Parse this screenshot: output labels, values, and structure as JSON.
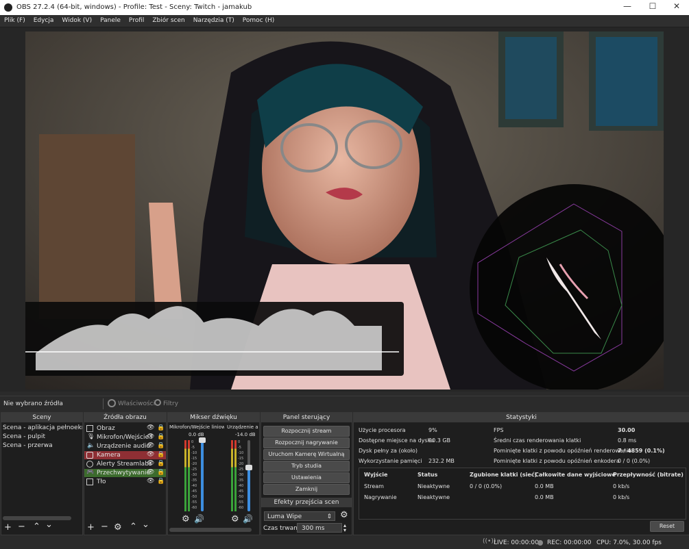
{
  "window": {
    "title": "OBS 27.2.4 (64-bit, windows) - Profile: Test - Sceny: Twitch - jamakub",
    "minimize": "—",
    "maximize": "☐",
    "close": "✕"
  },
  "menu": [
    "Plik (F)",
    "Edycja",
    "Widok (V)",
    "Panele",
    "Profil",
    "Zbiór scen",
    "Narzędzia (T)",
    "Pomoc (H)"
  ],
  "source_bar": {
    "status": "Nie wybrano źródła",
    "properties": "Właściwości",
    "filters": "Filtry"
  },
  "scenes": {
    "title": "Sceny",
    "items": [
      "Scena - aplikacja pełnoekranc",
      "Scena - pulpit",
      "Scena - przerwa"
    ]
  },
  "sources": {
    "title": "Źródła obrazu",
    "items": [
      {
        "label": "Obraz",
        "icon": "image-icon",
        "state": "normal"
      },
      {
        "label": "Mikrofon/Wejście l",
        "icon": "microphone-icon",
        "state": "normal"
      },
      {
        "label": "Urządzenie audio",
        "icon": "speaker-icon",
        "state": "normal"
      },
      {
        "label": "Kamera",
        "icon": "camera-icon",
        "state": "red"
      },
      {
        "label": "Alerty Streamlabs",
        "icon": "globe-icon",
        "state": "normal"
      },
      {
        "label": "Przechwytywanie",
        "icon": "gamepad-icon",
        "state": "green"
      },
      {
        "label": "Tło",
        "icon": "image-icon",
        "state": "normal"
      }
    ]
  },
  "mixer": {
    "title": "Mikser dźwięku",
    "channels": [
      {
        "name": "Mikrofon/Wejście liniowe",
        "db": "0.0 dB",
        "fader": 1.0
      },
      {
        "name": "Urządzenie aud",
        "db": "-14.0 dB",
        "fader": 0.62
      }
    ],
    "ticks": [
      "0",
      "-5",
      "-10",
      "-15",
      "-20",
      "-25",
      "-30",
      "-35",
      "-40",
      "-45",
      "-50",
      "-55",
      "-60"
    ]
  },
  "controls": {
    "title": "Panel sterujący",
    "buttons": [
      "Rozpocznij stream",
      "Rozpocznij nagrywanie",
      "Uruchom Kamerę Wirtualną",
      "Tryb studia",
      "Ustawienia",
      "Zamknij"
    ],
    "transitions_title": "Efekty przejścia scen",
    "transition": "Luma Wipe",
    "duration_label": "Czas trwania",
    "duration": "300 ms"
  },
  "stats": {
    "title": "Statystyki",
    "left": [
      {
        "k": "Użycie procesora",
        "v": "9%"
      },
      {
        "k": "Dostępne miejsce na dysku",
        "v": "90.3 GB"
      },
      {
        "k": "Dysk pełny za (około)",
        "v": ""
      },
      {
        "k": "Wykorzystanie pamięci",
        "v": "232.2 MB"
      }
    ],
    "right": [
      {
        "k": "FPS",
        "v": "30.00",
        "bold": true
      },
      {
        "k": "Średni czas renderowania klatki",
        "v": "0.8 ms",
        "bold": false
      },
      {
        "k": "Pominięte klatki z powodu opóźnień renderowania",
        "v": "7 / 4859 (0.1%)",
        "bold": true
      },
      {
        "k": "Pominięte klatki z powodu opóźnień enkodera",
        "v": "0 / 0 (0.0%)",
        "bold": false
      }
    ],
    "table": {
      "headers": [
        "Wyjście",
        "Status",
        "Zgubione klatki (sieć)",
        "Całkowite dane wyjściowe",
        "Przepływność (bitrate)"
      ],
      "rows": [
        [
          "Stream",
          "Nieaktywne",
          "0 / 0 (0.0%)",
          "0.0 MB",
          "0 kb/s"
        ],
        [
          "Nagrywanie",
          "Nieaktywne",
          "",
          "0.0 MB",
          "0 kb/s"
        ]
      ]
    },
    "reset": "Reset"
  },
  "status": {
    "live": "LIVE: 00:00:00",
    "rec": "REC: 00:00:00",
    "cpu": "CPU: 7.0%, 30.00 fps"
  }
}
